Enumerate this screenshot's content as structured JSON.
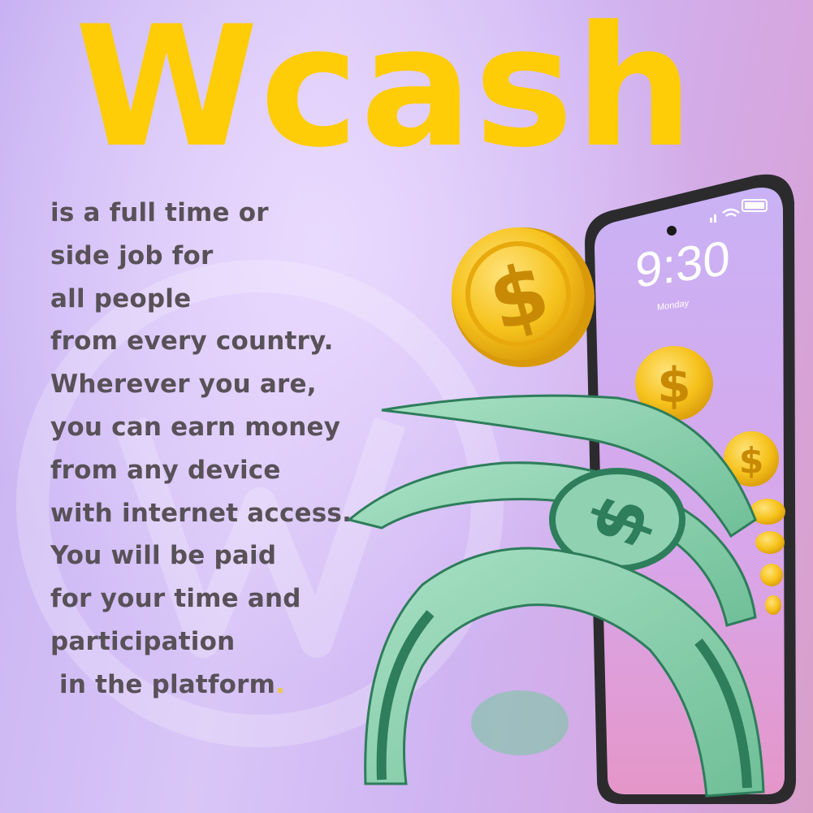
{
  "brand": {
    "title": "Wcash"
  },
  "body": {
    "lines": [
      "is a full time or",
      "side job for",
      "all people",
      "from every country.",
      "Wherever you are,",
      "you can earn money",
      "from any device",
      "with internet access.",
      "You will be paid",
      "for your time and",
      "participation",
      " in the platform"
    ],
    "end_mark": "."
  },
  "phone": {
    "time": "9:30",
    "day": "Monday"
  },
  "icons": [
    "signal-icon",
    "wifi-icon",
    "battery-icon",
    "dollar-coin-icon",
    "banknote-icon"
  ],
  "colors": {
    "brand_yellow": "#ffcc08",
    "text_gray": "#585158",
    "bill_green": "#8fd1b0",
    "bill_dark": "#2e7d5b",
    "coin_gold": "#f6c21c"
  }
}
